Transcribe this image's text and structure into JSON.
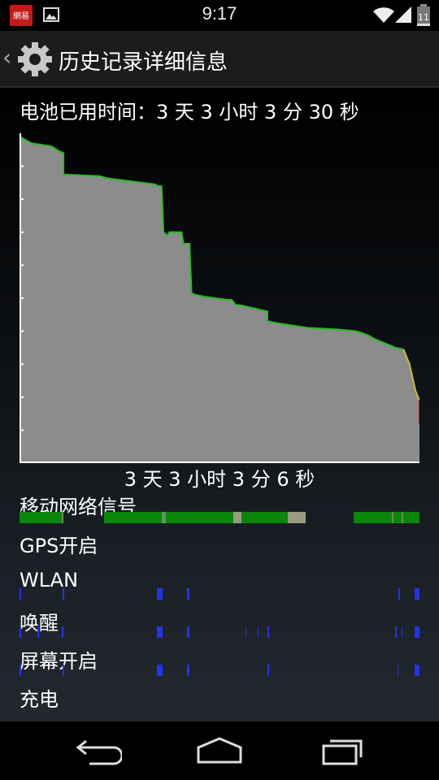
{
  "status_bar": {
    "time": "9:17",
    "app_icon_text": "網易",
    "battery_level": "11",
    "battery_level_fraction": 0.11
  },
  "action_bar": {
    "title": "历史记录详细信息"
  },
  "summary": {
    "battery_used": "电池已用时间：3 天 3 小时 3 分 30 秒",
    "duration": "3 天 3 小时 3 分 6 秒"
  },
  "chart_data": {
    "type": "area",
    "fill_color": "#8c8c8c",
    "line_colors": {
      "high": "#22c022",
      "medium": "#c8c020",
      "low": "#cc1111"
    },
    "x_range": [
      0,
      1
    ],
    "y_range": [
      0,
      1
    ],
    "points": [
      [
        0.0,
        0.99
      ],
      [
        0.03,
        0.97
      ],
      [
        0.08,
        0.96
      ],
      [
        0.1,
        0.945
      ],
      [
        0.11,
        0.94
      ],
      [
        0.11,
        0.875
      ],
      [
        0.2,
        0.87
      ],
      [
        0.215,
        0.865
      ],
      [
        0.24,
        0.86
      ],
      [
        0.34,
        0.845
      ],
      [
        0.345,
        0.84
      ],
      [
        0.355,
        0.84
      ],
      [
        0.36,
        0.7
      ],
      [
        0.37,
        0.69
      ],
      [
        0.375,
        0.7
      ],
      [
        0.405,
        0.7
      ],
      [
        0.41,
        0.665
      ],
      [
        0.425,
        0.665
      ],
      [
        0.43,
        0.515
      ],
      [
        0.44,
        0.51
      ],
      [
        0.46,
        0.505
      ],
      [
        0.52,
        0.495
      ],
      [
        0.53,
        0.495
      ],
      [
        0.54,
        0.48
      ],
      [
        0.555,
        0.478
      ],
      [
        0.6,
        0.465
      ],
      [
        0.62,
        0.46
      ],
      [
        0.62,
        0.43
      ],
      [
        0.64,
        0.425
      ],
      [
        0.72,
        0.41
      ],
      [
        0.8,
        0.405
      ],
      [
        0.84,
        0.4
      ],
      [
        0.855,
        0.395
      ],
      [
        0.875,
        0.385
      ],
      [
        0.89,
        0.375
      ],
      [
        0.92,
        0.36
      ],
      [
        0.94,
        0.35
      ],
      [
        0.96,
        0.345
      ],
      [
        0.975,
        0.3
      ],
      [
        0.99,
        0.22
      ],
      [
        1.0,
        0.19
      ],
      [
        1.0,
        0.12
      ]
    ],
    "yellow_from_index": 37,
    "red_from_index": 40
  },
  "signal": {
    "label": "移动网络信号",
    "segments": [
      {
        "start": 0.0,
        "end": 0.105,
        "color": "#0a870a"
      },
      {
        "start": 0.105,
        "end": 0.11,
        "color": "#6a8a5a"
      },
      {
        "start": 0.212,
        "end": 0.355,
        "color": "#0a870a"
      },
      {
        "start": 0.355,
        "end": 0.365,
        "color": "#5a9a5a"
      },
      {
        "start": 0.365,
        "end": 0.535,
        "color": "#0a870a"
      },
      {
        "start": 0.535,
        "end": 0.555,
        "color": "#9a9a80"
      },
      {
        "start": 0.555,
        "end": 0.67,
        "color": "#0a870a"
      },
      {
        "start": 0.67,
        "end": 0.715,
        "color": "#9a9a80"
      },
      {
        "start": 0.835,
        "end": 0.93,
        "color": "#0a870a"
      },
      {
        "start": 0.93,
        "end": 0.935,
        "color": "#6a8a5a"
      },
      {
        "start": 0.935,
        "end": 0.955,
        "color": "#0a870a"
      },
      {
        "start": 0.955,
        "end": 0.96,
        "color": "#6a8a5a"
      },
      {
        "start": 0.96,
        "end": 1.0,
        "color": "#0a870a"
      }
    ]
  },
  "gps": {
    "label": "GPS开启",
    "segments": []
  },
  "wlan": {
    "label": "WLAN",
    "segments": [
      {
        "start": 0.0,
        "end": 0.002
      },
      {
        "start": 0.108,
        "end": 0.11
      },
      {
        "start": 0.343,
        "end": 0.358
      },
      {
        "start": 0.418,
        "end": 0.425
      },
      {
        "start": 0.948,
        "end": 0.95
      },
      {
        "start": 0.988,
        "end": 1.0
      }
    ]
  },
  "wakelock": {
    "label": "唤醒",
    "segments": [
      {
        "start": 0.0,
        "end": 0.003
      },
      {
        "start": 0.045,
        "end": 0.048
      },
      {
        "start": 0.105,
        "end": 0.11
      },
      {
        "start": 0.343,
        "end": 0.358
      },
      {
        "start": 0.418,
        "end": 0.425
      },
      {
        "start": 0.565,
        "end": 0.567
      },
      {
        "start": 0.595,
        "end": 0.597
      },
      {
        "start": 0.62,
        "end": 0.623
      },
      {
        "start": 0.94,
        "end": 0.943
      },
      {
        "start": 0.955,
        "end": 0.958
      },
      {
        "start": 0.988,
        "end": 1.0
      }
    ]
  },
  "screen_on": {
    "label": "屏幕开启",
    "segments": [
      {
        "start": 0.0,
        "end": 0.002
      },
      {
        "start": 0.108,
        "end": 0.11
      },
      {
        "start": 0.343,
        "end": 0.358
      },
      {
        "start": 0.418,
        "end": 0.425
      },
      {
        "start": 0.62,
        "end": 0.623
      },
      {
        "start": 0.945,
        "end": 0.948
      },
      {
        "start": 0.988,
        "end": 1.0
      }
    ]
  },
  "charging": {
    "label": "充电",
    "segments": []
  },
  "colors": {
    "active_blue": "#2233ee",
    "chart_fill": "#8c8c8c"
  },
  "nav": {
    "back_icon": "back-arrow-icon",
    "home_icon": "home-icon",
    "recents_icon": "recents-icon"
  }
}
